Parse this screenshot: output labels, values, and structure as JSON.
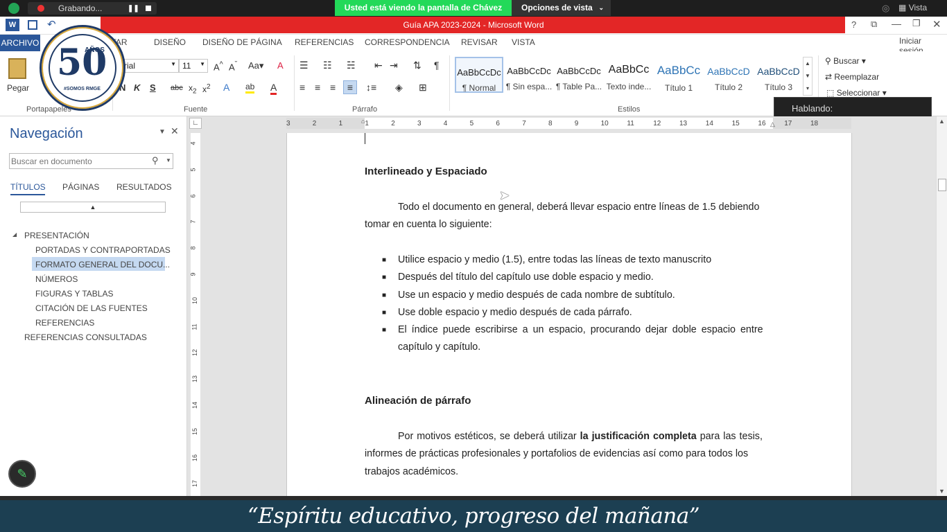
{
  "zoom": {
    "recording_label": "Grabando...",
    "viewing_text": "Usted está viendo la pantalla de Chávez",
    "view_options": "Opciones de vista",
    "view_label": "Vista",
    "speaking_label": "Hablando:"
  },
  "window": {
    "title": "Guía APA 2023-2024 -  Microsoft Word",
    "signin": "Iniciar sesión"
  },
  "tabs": [
    "ARCHIVO",
    "INSERTAR",
    "DISEÑO",
    "DISEÑO DE PÁGINA",
    "REFERENCIAS",
    "CORRESPONDENCIA",
    "REVISAR",
    "VISTA"
  ],
  "ribbon": {
    "paste_label": "Pegar",
    "font_name": "Arial",
    "font_size": "11",
    "groups": [
      "Portapapeles",
      "Fuente",
      "Párrafo",
      "Estilos"
    ],
    "styles": [
      {
        "preview": "AaBbCcDc",
        "name": "¶ Normal"
      },
      {
        "preview": "AaBbCcDc",
        "name": "¶ Sin espa..."
      },
      {
        "preview": "AaBbCcDc",
        "name": "¶ Table Pa..."
      },
      {
        "preview": "AaBbCc",
        "name": "Texto inde..."
      },
      {
        "preview": "AaBbCc",
        "name": "Título 1"
      },
      {
        "preview": "AaBbCcD",
        "name": "Título 2"
      },
      {
        "preview": "AaBbCcD",
        "name": "Título 3"
      }
    ],
    "editing": {
      "find": "Buscar",
      "replace": "Reemplazar",
      "select": "Seleccionar"
    }
  },
  "logo": {
    "years_text": "AÑOS",
    "tag": "#SOMOS RMGE"
  },
  "nav": {
    "title": "Navegación",
    "search_placeholder": "Buscar en documento",
    "tabs": [
      "TÍTULOS",
      "PÁGINAS",
      "RESULTADOS"
    ],
    "items": [
      {
        "label": "PRESENTACIÓN",
        "level": 1
      },
      {
        "label": "PORTADAS Y CONTRAPORTADAS",
        "level": 2
      },
      {
        "label": "FORMATO GENERAL DEL DOCU...",
        "level": 2,
        "selected": true
      },
      {
        "label": "NÚMEROS",
        "level": 2
      },
      {
        "label": "FIGURAS Y TABLAS",
        "level": 2
      },
      {
        "label": "CITACIÓN DE LAS FUENTES",
        "level": 2
      },
      {
        "label": "REFERENCIAS",
        "level": 2
      },
      {
        "label": "REFERENCIAS CONSULTADAS",
        "level": 1
      }
    ]
  },
  "ruler": {
    "h_numbers": [
      "3",
      "2",
      "1",
      "1",
      "2",
      "3",
      "4",
      "5",
      "6",
      "7",
      "8",
      "9",
      "10",
      "11",
      "12",
      "13",
      "14",
      "15",
      "16",
      "17",
      "18"
    ],
    "v_numbers": [
      "4",
      "5",
      "6",
      "7",
      "8",
      "9",
      "10",
      "11",
      "12",
      "13",
      "14",
      "15",
      "16",
      "17"
    ]
  },
  "doc": {
    "h1": "Interlineado y Espaciado",
    "p1_line1": "Todo el documento en general, deberá llevar espacio entre líneas de 1.5 debiendo",
    "p1_line2": "tomar en cuenta lo siguiente:",
    "bullets": [
      "Utilice espacio y medio (1.5), entre todas las líneas de texto manuscrito",
      "Después del título del capítulo use doble espacio y medio.",
      "Use un espacio y medio después de cada nombre de subtítulo.",
      "Use doble espacio y medio después de cada párrafo.",
      "El índice puede escribirse a un espacio, procurando dejar doble espacio entre",
      "capítulo y capítulo."
    ],
    "h2": "Alineación de párrafo",
    "p2_line1_a": "Por motivos estéticos, se deberá utilizar ",
    "p2_line1_b": "la justificación completa",
    "p2_line1_c": " para las tesis,",
    "p2_line2": "informes de prácticas profesionales y portafolios de evidencias así como para todos los",
    "p2_line3": "trabajos académicos."
  },
  "banner": {
    "text": "“Espíritu educativo, progreso del mañana”"
  },
  "colors": {
    "word_red": "#e32626",
    "zoom_green": "#23d959",
    "banner_bg": "#1c3f52",
    "nav_blue": "#2b579a",
    "selected_bg": "#c5d9f1"
  }
}
